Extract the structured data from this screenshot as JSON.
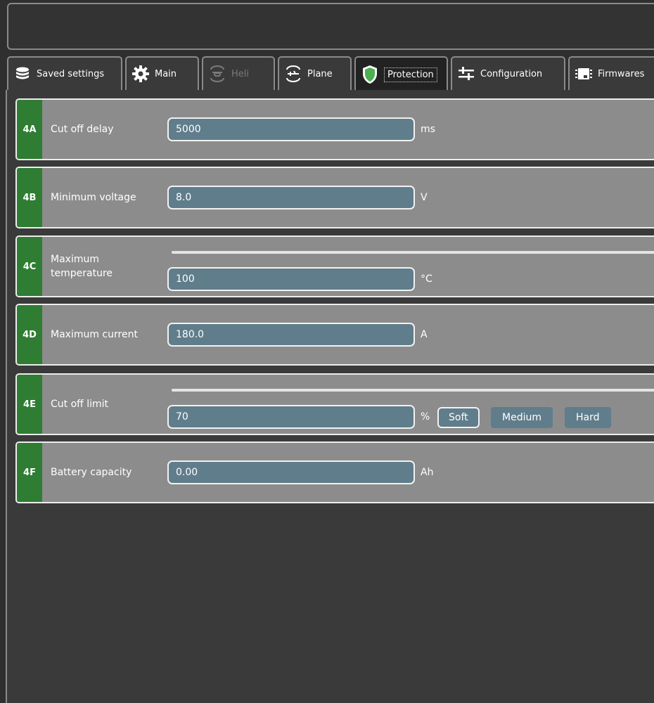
{
  "tabs": [
    {
      "label": "Saved settings",
      "icon": "database-icon",
      "state": "normal"
    },
    {
      "label": "Main",
      "icon": "gear-icon",
      "state": "normal"
    },
    {
      "label": "Heli",
      "icon": "helicopter-icon",
      "state": "disabled"
    },
    {
      "label": "Plane",
      "icon": "plane-icon",
      "state": "normal"
    },
    {
      "label": "Protection",
      "icon": "shield-icon",
      "state": "active"
    },
    {
      "label": "Configuration",
      "icon": "sliders-icon",
      "state": "normal"
    },
    {
      "label": "Firmwares",
      "icon": "chip-icon",
      "state": "normal"
    }
  ],
  "colors": {
    "badge": "#2e7d32",
    "card": "#8c8c8c",
    "field": "#607d8b",
    "shield": "#4caf50",
    "background": "#2f2f2f"
  },
  "settings": [
    {
      "code": "4A",
      "label": "Cut off delay",
      "value": "5000",
      "unit": "ms"
    },
    {
      "code": "4B",
      "label": "Minimum voltage",
      "value": "8.0",
      "unit": "V"
    },
    {
      "code": "4C",
      "label": "Maximum temperature",
      "value": "100",
      "unit": "°C",
      "has_slider": true
    },
    {
      "code": "4D",
      "label": "Maximum current",
      "value": "180.0",
      "unit": "A"
    },
    {
      "code": "4E",
      "label": "Cut off limit",
      "value": "70",
      "unit": "%",
      "has_slider": true,
      "presets": [
        {
          "label": "Soft",
          "selected": true
        },
        {
          "label": "Medium",
          "selected": false
        },
        {
          "label": "Hard",
          "selected": false
        }
      ]
    },
    {
      "code": "4F",
      "label": "Battery capacity",
      "value": "0.00",
      "unit": "Ah"
    }
  ]
}
